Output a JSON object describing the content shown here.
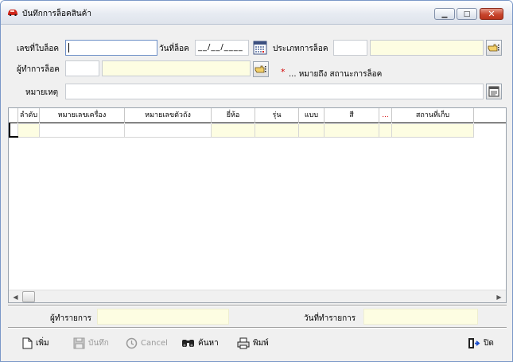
{
  "window": {
    "title": "บันทึกการล็อคสินค้า",
    "controls": {
      "minimize": "▁",
      "maximize": "□",
      "close": "✕"
    }
  },
  "form": {
    "lock_no_label": "เลขที่ใบล็อค",
    "lock_no_value": "",
    "lock_date_label": "วันที่ล็อค",
    "lock_date_value": "__/__/____",
    "lock_type_label": "ประเภทการล็อค",
    "lock_type_code": "",
    "lock_type_name": "",
    "locker_label": "ผู้ทำการล็อค",
    "locker_code": "",
    "locker_name": "",
    "note_star": "*",
    "note_text": "... หมายถึง สถานะการล็อค",
    "remark_label": "หมายเหตุ",
    "remark_value": ""
  },
  "grid": {
    "columns": [
      "ลำดับ",
      "หมายเลขเครื่อง",
      "หมายเลขตัวถัง",
      "ยี่ห้อ",
      "รุ่น",
      "แบบ",
      "สี",
      "...",
      "สถานที่เก็บ"
    ]
  },
  "footer": {
    "creator_label": "ผู้ทำรายการ",
    "creator_value": "",
    "created_date_label": "วันที่ทำรายการ",
    "created_date_value": ""
  },
  "toolbar": {
    "add_label": "เพิ่ม",
    "save_label": "บันทึก",
    "cancel_label": "Cancel",
    "search_label": "ค้นหา",
    "print_label": "พิมพ์",
    "close_label": "ปิด"
  },
  "colors": {
    "window_bg": "#f0f0f0",
    "readonly_field": "#fdfde2",
    "required_mark": "#d40000",
    "close_button": "#c8452d"
  }
}
